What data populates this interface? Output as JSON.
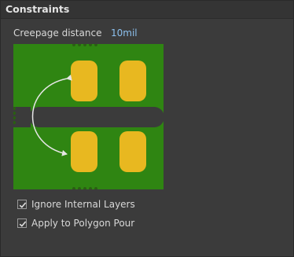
{
  "panel": {
    "title": "Constraints"
  },
  "creepage": {
    "label": "Creepage distance",
    "value": "10mil"
  },
  "diagram": {
    "board_color": "#2f8512",
    "pad_color": "#e8b820",
    "slot_color": "#3b3b3b",
    "arrow_color": "#e6e6e6"
  },
  "options": [
    {
      "label": "Ignore Internal Layers",
      "checked": true
    },
    {
      "label": "Apply to Polygon Pour",
      "checked": true
    }
  ]
}
